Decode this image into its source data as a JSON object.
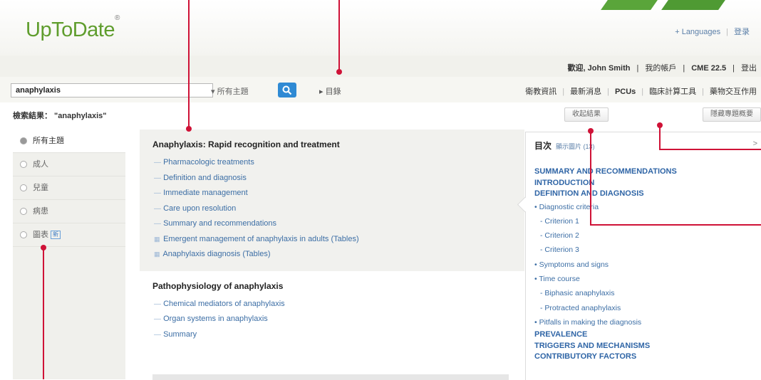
{
  "header": {
    "logo": "UpToDate",
    "logo_mark": "®",
    "languages_link": "+ Languages",
    "login_link": "登录"
  },
  "user_bar": {
    "welcome": "歡迎, John Smith",
    "my_account": "我的帳戶",
    "cme": "CME 22.5",
    "logout": "登出"
  },
  "search": {
    "value": "anaphylaxis",
    "scope": "▾ 所有主題",
    "contents": "▸ 目錄",
    "top_links": [
      "衛教資訊",
      "最新消息",
      "PCUs",
      "臨床計算工具",
      "藥物交互作用"
    ]
  },
  "results_bar": {
    "label": "檢索結果： \"anaphylaxis\"",
    "collapse_btn": "收起結果",
    "summary_btn": "隱藏專題概要"
  },
  "filters": [
    {
      "label": "所有主題",
      "active": true
    },
    {
      "label": "成人",
      "active": false
    },
    {
      "label": "兒童",
      "active": false
    },
    {
      "label": "病患",
      "active": false
    },
    {
      "label": "圖表",
      "active": false,
      "badge": "新"
    }
  ],
  "results": [
    {
      "title": "Anaphylaxis: Rapid recognition and treatment",
      "links": [
        {
          "text": "Pharmacologic treatments",
          "type": "section"
        },
        {
          "text": "Definition and diagnosis",
          "type": "section"
        },
        {
          "text": "Immediate management",
          "type": "section"
        },
        {
          "text": "Care upon resolution",
          "type": "section"
        },
        {
          "text": "Summary and recommendations",
          "type": "section"
        },
        {
          "text": "Emergent management of anaphylaxis in adults (Tables)",
          "type": "table"
        },
        {
          "text": "Anaphylaxis diagnosis (Tables)",
          "type": "table"
        }
      ]
    },
    {
      "title": "Pathophysiology of anaphylaxis",
      "links": [
        {
          "text": "Chemical mediators of anaphylaxis",
          "type": "section"
        },
        {
          "text": "Organ systems in anaphylaxis",
          "type": "section"
        },
        {
          "text": "Summary",
          "type": "section"
        }
      ]
    }
  ],
  "toc": {
    "title": "目次",
    "show_images": "顯示圖片 (13)",
    "close": ">",
    "items": [
      {
        "text": "SUMMARY AND RECOMMENDATIONS",
        "level": "h"
      },
      {
        "text": "INTRODUCTION",
        "level": "h"
      },
      {
        "text": "DEFINITION AND DIAGNOSIS",
        "level": "h"
      },
      {
        "text": "• Diagnostic criteria",
        "level": "l1"
      },
      {
        "text": "- Criterion 1",
        "level": "l2"
      },
      {
        "text": "- Criterion 2",
        "level": "l2"
      },
      {
        "text": "- Criterion 3",
        "level": "l2"
      },
      {
        "text": "• Symptoms and signs",
        "level": "l1"
      },
      {
        "text": "• Time course",
        "level": "l1"
      },
      {
        "text": "- Biphasic anaphylaxis",
        "level": "l2"
      },
      {
        "text": "- Protracted anaphylaxis",
        "level": "l2"
      },
      {
        "text": "• Pitfalls in making the diagnosis",
        "level": "l1"
      },
      {
        "text": "PREVALENCE",
        "level": "h"
      },
      {
        "text": "TRIGGERS AND MECHANISMS",
        "level": "h"
      },
      {
        "text": "CONTRIBUTORY FACTORS",
        "level": "h"
      }
    ]
  },
  "colors": {
    "brand_green": "#5f9d2d",
    "link_blue": "#3c6ea5",
    "search_button": "#2f8ad4",
    "callout_red": "#cf1237"
  }
}
